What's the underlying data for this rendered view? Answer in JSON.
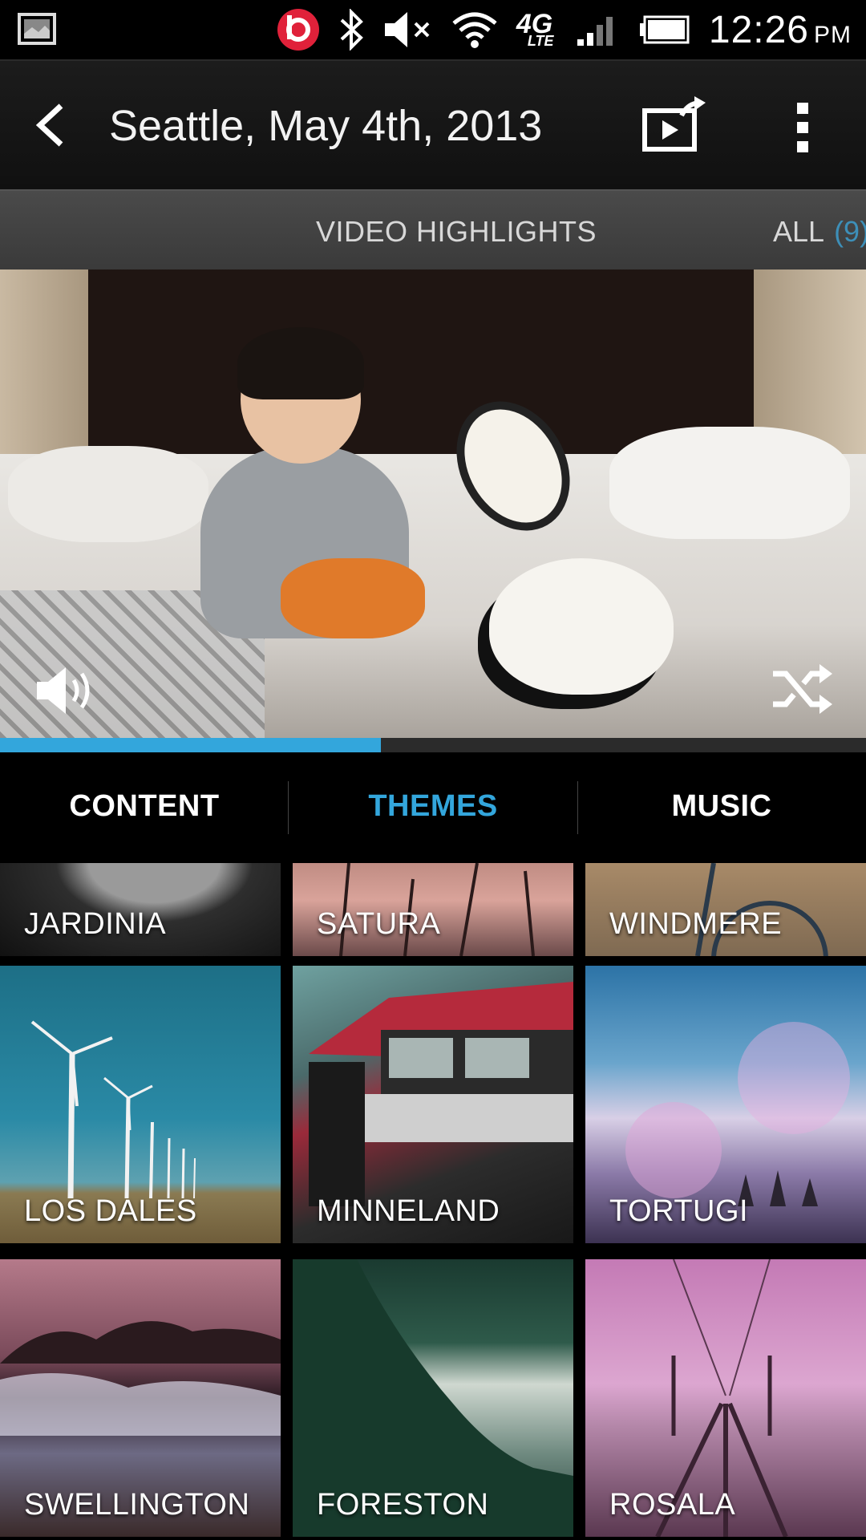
{
  "status_bar": {
    "time": "12:26",
    "ampm": "PM",
    "icons": [
      "gallery-icon",
      "beats-icon",
      "bluetooth-icon",
      "mute-icon",
      "wifi-icon",
      "4g-lte-icon",
      "signal-icon",
      "battery-icon"
    ],
    "network_label": "4G",
    "network_sub": "LTE"
  },
  "action_bar": {
    "title": "Seattle, May 4th, 2013",
    "icons": [
      "back-icon",
      "share-video-icon",
      "overflow-menu-icon"
    ]
  },
  "sub_tabs": {
    "video_highlights": "VIDEO HIGHLIGHTS",
    "all": "ALL",
    "all_count": "(9)"
  },
  "video": {
    "progress_percent": 44,
    "icons": [
      "volume-icon",
      "shuffle-icon"
    ]
  },
  "main_tabs": [
    {
      "label": "CONTENT",
      "active": false
    },
    {
      "label": "THEMES",
      "active": true
    },
    {
      "label": "MUSIC",
      "active": false
    }
  ],
  "themes": [
    {
      "name": "JARDINIA"
    },
    {
      "name": "SATURA"
    },
    {
      "name": "WINDMERE"
    },
    {
      "name": "LOS DALES"
    },
    {
      "name": "MINNELAND"
    },
    {
      "name": "TORTUGI"
    },
    {
      "name": "SWELLINGTON"
    },
    {
      "name": "FORESTON"
    },
    {
      "name": "ROSALA"
    }
  ],
  "colors": {
    "accent": "#33a6dc",
    "background": "#000000",
    "sub_tab_bg": "#3f3f3f"
  }
}
